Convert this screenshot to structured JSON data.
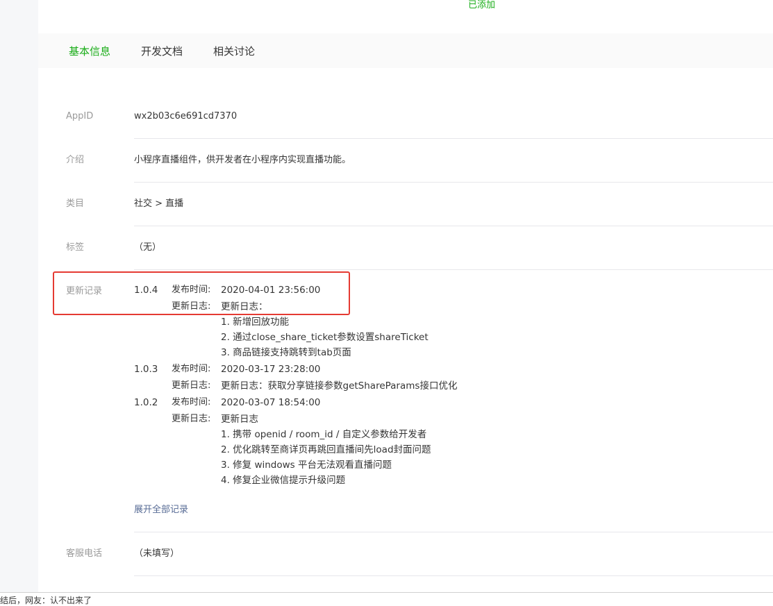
{
  "header": {
    "added_status": "已添加"
  },
  "tabs": [
    {
      "label": "基本信息",
      "active": true
    },
    {
      "label": "开发文档",
      "active": false
    },
    {
      "label": "相关讨论",
      "active": false
    }
  ],
  "info": {
    "appid": {
      "label": "AppID",
      "value": "wx2b03c6e691cd7370"
    },
    "intro": {
      "label": "介绍",
      "value": "小程序直播组件，供开发者在小程序内实现直播功能。"
    },
    "category": {
      "label": "类目",
      "value": "社交 > 直播"
    },
    "tags": {
      "label": "标签",
      "value": "（无）"
    },
    "service_phone": {
      "label": "客服电话",
      "value": "（未填写）"
    }
  },
  "updates": {
    "label": "更新记录",
    "publish_label": "发布时间:",
    "log_label": "更新日志:",
    "versions": [
      {
        "version": "1.0.4",
        "time": "2020-04-01 23:56:00",
        "log": [
          "更新日志：",
          "1. 新增回放功能",
          "2. 通过close_share_ticket参数设置shareTicket",
          "3. 商品链接支持跳转到tab页面"
        ]
      },
      {
        "version": "1.0.3",
        "time": "2020-03-17 23:28:00",
        "log": [
          "更新日志：获取分享链接参数getShareParams接口优化"
        ]
      },
      {
        "version": "1.0.2",
        "time": "2020-03-07 18:54:00",
        "log": [
          "更新日志",
          "1. 携带 openid / room_id / 自定义参数给开发者",
          "2. 优化跳转至商详页再跳回直播间先load封面问题",
          "3. 修复 windows 平台无法观看直播问题",
          "4. 修复企业微信提示升级问题"
        ]
      }
    ],
    "expand_label": "展开全部记录"
  },
  "colors": {
    "accent": "#1aad19",
    "link": "#576b95",
    "highlight": "#e53a32"
  },
  "footer": {
    "text": "结后，网友：认不出来了"
  }
}
